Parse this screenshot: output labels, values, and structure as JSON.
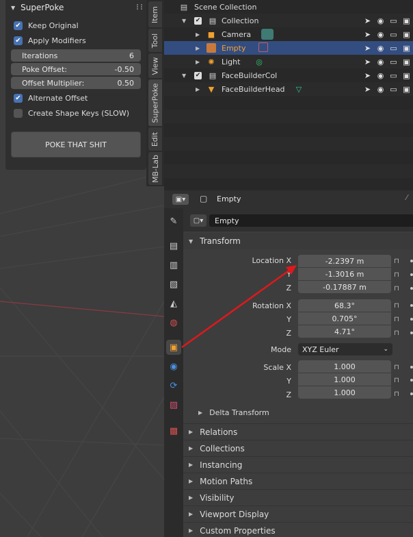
{
  "superpoke": {
    "title": "SuperPoke",
    "keep_original": "Keep Original",
    "apply_modifiers": "Apply Modifiers",
    "iterations_label": "Iterations",
    "iterations_value": "6",
    "poke_offset_label": "Poke Offset:",
    "poke_offset_value": "-0.50",
    "offset_mult_label": "Offset Multiplier:",
    "offset_mult_value": "0.50",
    "alternate_offset": "Alternate Offset",
    "create_shape_keys": "Create Shape Keys (SLOW)",
    "poke_button": "POKE THAT SHIT"
  },
  "sidebar_tabs": [
    "Item",
    "Tool",
    "View",
    "SuperPoke",
    "Edit",
    "MB-Lab"
  ],
  "outliner": {
    "scene_collection": "Scene Collection",
    "collection": "Collection",
    "camera": "Camera",
    "empty": "Empty",
    "light": "Light",
    "facebuilder_col": "FaceBuilderCol",
    "facebuilder_head": "FaceBuilderHead"
  },
  "properties": {
    "header_object": "Empty",
    "name_field": "Empty",
    "transform": "Transform",
    "location_x_label": "Location X",
    "location_y_label": "Y",
    "location_z_label": "Z",
    "location_x": "-2.2397 m",
    "location_y": "-1.3016 m",
    "location_z": "-0.17887 m",
    "rotation_x_label": "Rotation X",
    "rotation_y_label": "Y",
    "rotation_z_label": "Z",
    "rotation_x": "68.3°",
    "rotation_y": "0.705°",
    "rotation_z": "4.71°",
    "mode_label": "Mode",
    "mode_value": "XYZ Euler",
    "scale_x_label": "Scale X",
    "scale_y_label": "Y",
    "scale_z_label": "Z",
    "scale_x": "1.000",
    "scale_y": "1.000",
    "scale_z": "1.000",
    "delta_transform": "Delta Transform",
    "relations": "Relations",
    "collections": "Collections",
    "instancing": "Instancing",
    "motion_paths": "Motion Paths",
    "visibility": "Visibility",
    "viewport_display": "Viewport Display",
    "custom_properties": "Custom Properties"
  },
  "colors": {
    "accent": "#4772b3",
    "selected_row": "#334d80",
    "arrow": "#e0181c"
  }
}
